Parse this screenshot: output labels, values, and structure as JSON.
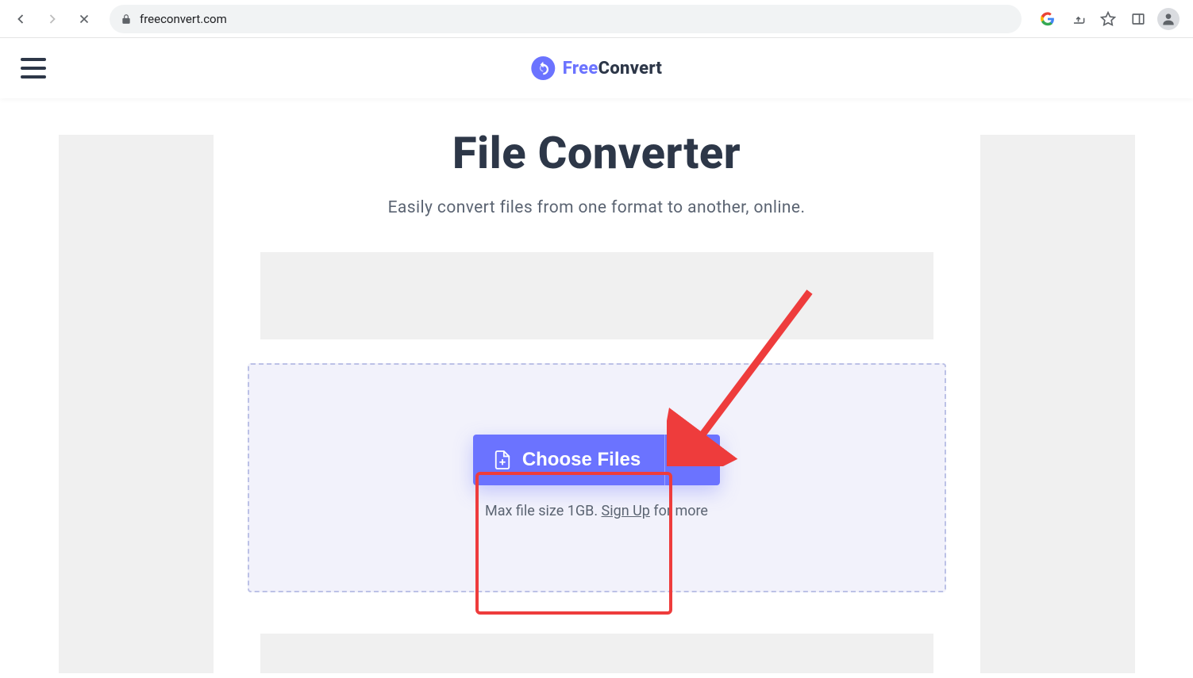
{
  "browser": {
    "url": "freeconvert.com"
  },
  "logo": {
    "part1": "Free",
    "part2": "Convert"
  },
  "main": {
    "title": "File Converter",
    "subtitle": "Easily convert files from one format to another, online."
  },
  "upload": {
    "choose_label": "Choose Files",
    "note_prefix": "Max file size 1GB. ",
    "signup_label": "Sign Up",
    "note_suffix": " for more"
  }
}
